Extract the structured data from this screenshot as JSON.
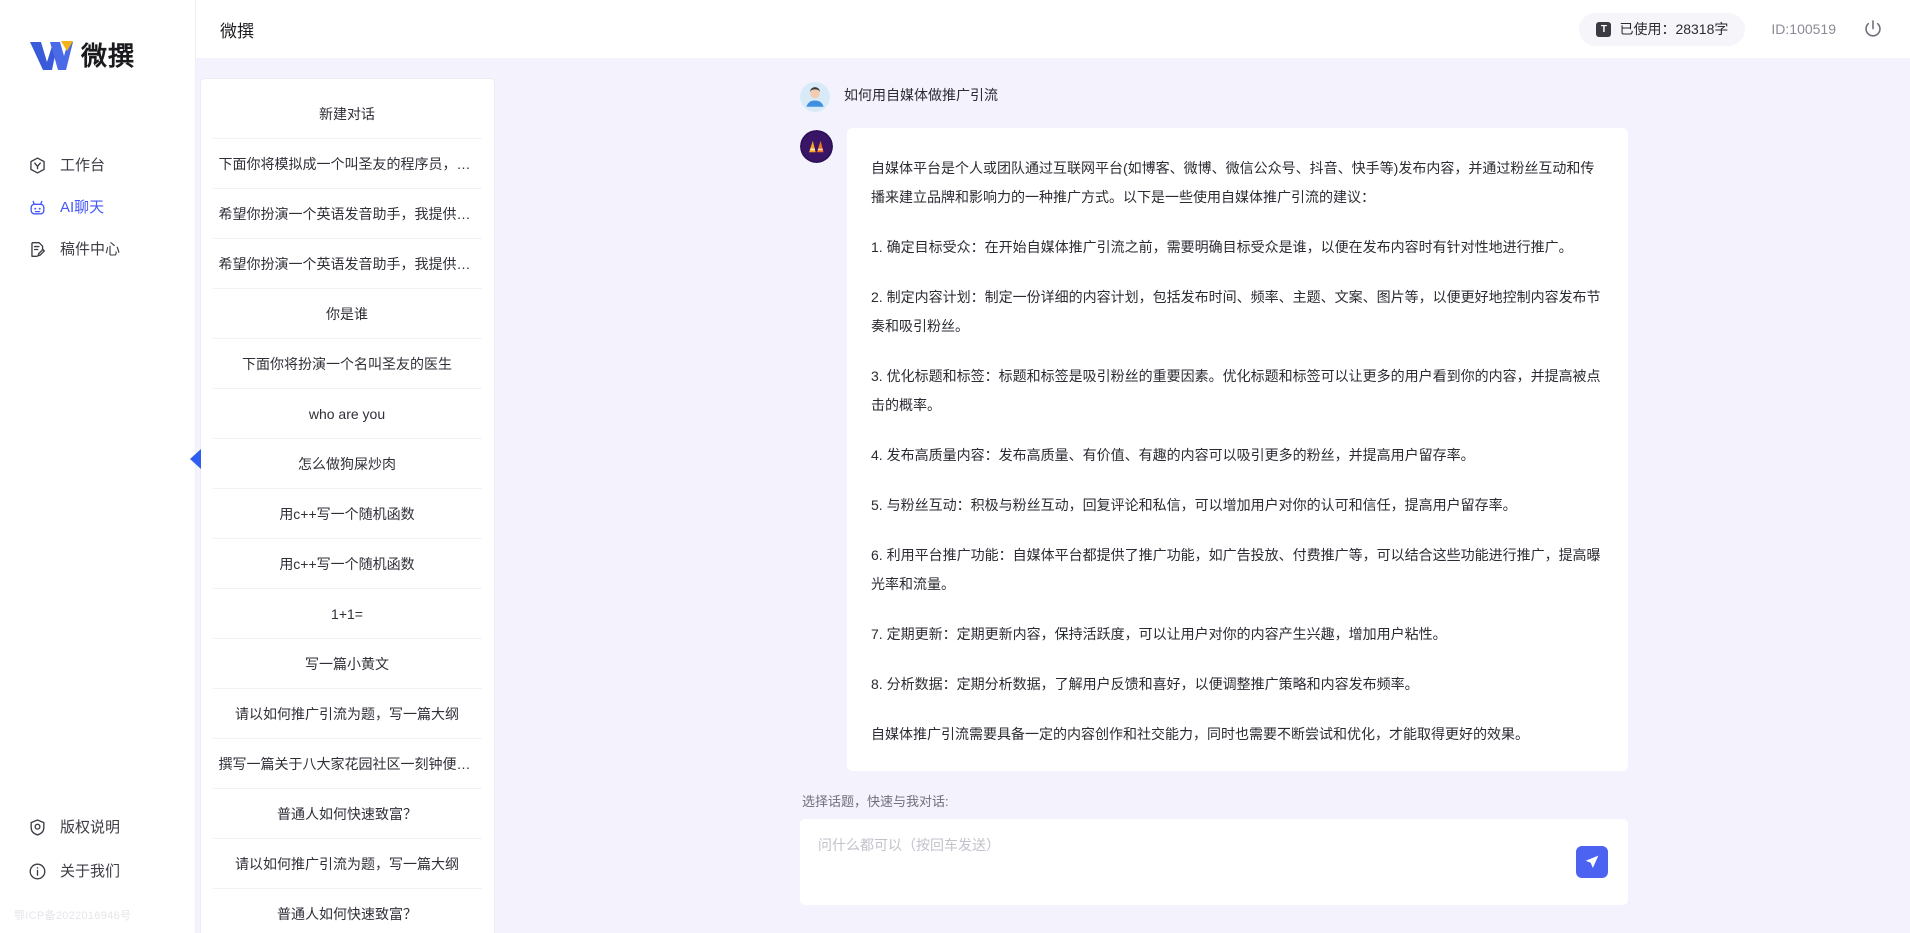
{
  "brand": {
    "name": "微撰",
    "logo_icon": "w-logo-icon"
  },
  "sidebar": {
    "nav_items": [
      {
        "label": "工作台",
        "icon": "workbench-hexagon-icon",
        "active": false
      },
      {
        "label": "AI聊天",
        "icon": "robot-icon",
        "active": true
      },
      {
        "label": "稿件中心",
        "icon": "document-edit-icon",
        "active": false
      }
    ],
    "footer_items": [
      {
        "label": "版权说明",
        "icon": "shield-icon"
      },
      {
        "label": "关于我们",
        "icon": "info-icon"
      }
    ],
    "icp": "鄂ICP备2022016946号"
  },
  "topbar": {
    "title": "微撰",
    "usage_chip_icon": "text-badge-icon",
    "usage_label": "已使用：28318字",
    "user_id": "ID:100519",
    "power_icon": "power-icon"
  },
  "conversations": {
    "new_chat_label": "新建对话",
    "items": [
      "下面你将模拟成一个叫圣友的程序员，我说...",
      "希望你扮演一个英语发音助手，我提供给你...",
      "希望你扮演一个英语发音助手，我提供给你...",
      "你是谁",
      "下面你将扮演一个名叫圣友的医生",
      "who are you",
      "怎么做狗屎炒肉",
      "用c++写一个随机函数",
      "用c++写一个随机函数",
      "1+1=",
      "写一篇小黄文",
      "请以如何推广引流为题，写一篇大纲",
      "撰写一篇关于八大家花园社区一刻钟便民生...",
      "普通人如何快速致富？",
      "请以如何推广引流为题，写一篇大纲",
      "普通人如何快速致富？"
    ],
    "collapse_icon": "chevron-left-icon"
  },
  "chat": {
    "user_avatar_icon": "user-avatar-icon",
    "ai_avatar_icon": "ai-avatar-icon",
    "user_message": "如何用自媒体做推广引流",
    "ai_paragraphs": [
      "自媒体平台是个人或团队通过互联网平台(如博客、微博、微信公众号、抖音、快手等)发布内容，并通过粉丝互动和传播来建立品牌和影响力的一种推广方式。以下是一些使用自媒体推广引流的建议：",
      "1. 确定目标受众：在开始自媒体推广引流之前，需要明确目标受众是谁，以便在发布内容时有针对性地进行推广。",
      "2. 制定内容计划：制定一份详细的内容计划，包括发布时间、频率、主题、文案、图片等，以便更好地控制内容发布节奏和吸引粉丝。",
      "3. 优化标题和标签：标题和标签是吸引粉丝的重要因素。优化标题和标签可以让更多的用户看到你的内容，并提高被点击的概率。",
      "4. 发布高质量内容：发布高质量、有价值、有趣的内容可以吸引更多的粉丝，并提高用户留存率。",
      "5. 与粉丝互动：积极与粉丝互动，回复评论和私信，可以增加用户对你的认可和信任，提高用户留存率。",
      "6. 利用平台推广功能：自媒体平台都提供了推广功能，如广告投放、付费推广等，可以结合这些功能进行推广，提高曝光率和流量。",
      "7. 定期更新：定期更新内容，保持活跃度，可以让用户对你的内容产生兴趣，增加用户粘性。",
      "8. 分析数据：定期分析数据，了解用户反馈和喜好，以便调整推广策略和内容发布频率。",
      "自媒体推广引流需要具备一定的内容创作和社交能力，同时也需要不断尝试和优化，才能取得更好的效果。"
    ]
  },
  "composer": {
    "topic_hint": "选择话题，快速与我对话:",
    "placeholder": "问什么都可以（按回车发送）",
    "input_value": "",
    "send_icon": "send-plane-icon"
  },
  "colors": {
    "accent": "#4b63f0",
    "active_nav": "#4759f5",
    "page_bg": "#f4f3fd",
    "panel_bg": "#ffffff"
  }
}
